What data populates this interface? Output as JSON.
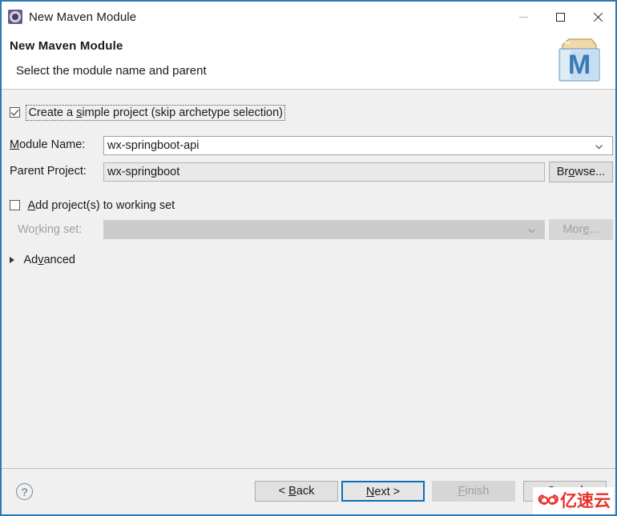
{
  "window": {
    "title": "New Maven Module",
    "icon": "maven-module-icon",
    "border_color": "#2b7ab5",
    "controls": {
      "minimize": "minimize-icon",
      "maximize": "maximize-icon",
      "close": "close-icon"
    }
  },
  "header": {
    "title": "New Maven Module",
    "description": "Select the module name and parent",
    "logo": "maven-folder-logo",
    "logo_letter": "M"
  },
  "form": {
    "simple_project": {
      "label_pre": "Create a ",
      "label_mnemonic": "s",
      "label_post": "imple project (skip archetype selection)",
      "full_label": "Create a simple project (skip archetype selection)",
      "checked": true,
      "focused": true
    },
    "module_name": {
      "label_mnemonic": "M",
      "label_rest": "odule Name:",
      "full_label": "Module Name:",
      "value": "wx-springboot-api",
      "placeholder": ""
    },
    "parent_project": {
      "full_label": "Parent Project:",
      "value": "wx-springboot",
      "placeholder": "",
      "browse_pre": "Br",
      "browse_mnemonic": "o",
      "browse_post": "wse...",
      "browse_label": "Browse..."
    },
    "add_to_working_set": {
      "label_mnemonic": "A",
      "label_rest": "dd project(s) to working set",
      "full_label": "Add project(s) to working set",
      "checked": false
    },
    "working_set": {
      "label_pre": "Wo",
      "label_mnemonic": "r",
      "label_post": "king set:",
      "full_label": "Working set:",
      "value": "",
      "disabled": true,
      "more_pre": "Mor",
      "more_mnemonic": "e",
      "more_post": "...",
      "more_label": "More...",
      "more_disabled": true
    },
    "advanced": {
      "label_pre": "Ad",
      "label_mnemonic": "v",
      "label_post": "anced",
      "full_label": "Advanced",
      "expanded": false
    }
  },
  "buttonbar": {
    "help": "?",
    "back": {
      "pre": "< ",
      "mnemonic": "B",
      "post": "ack",
      "label": "< Back",
      "disabled": false
    },
    "next": {
      "pre": "",
      "mnemonic": "N",
      "post": "ext >",
      "label": "Next >",
      "disabled": false,
      "focused": true
    },
    "finish": {
      "pre": "",
      "mnemonic": "F",
      "post": "inish",
      "label": "Finish",
      "disabled": true
    },
    "cancel": {
      "pre": "",
      "mnemonic": "",
      "post": "Cancel",
      "label": "Cancel",
      "disabled": false
    }
  },
  "watermark": {
    "text": "亿速云",
    "logo": "cloud-logo",
    "color": "#e8312a"
  }
}
